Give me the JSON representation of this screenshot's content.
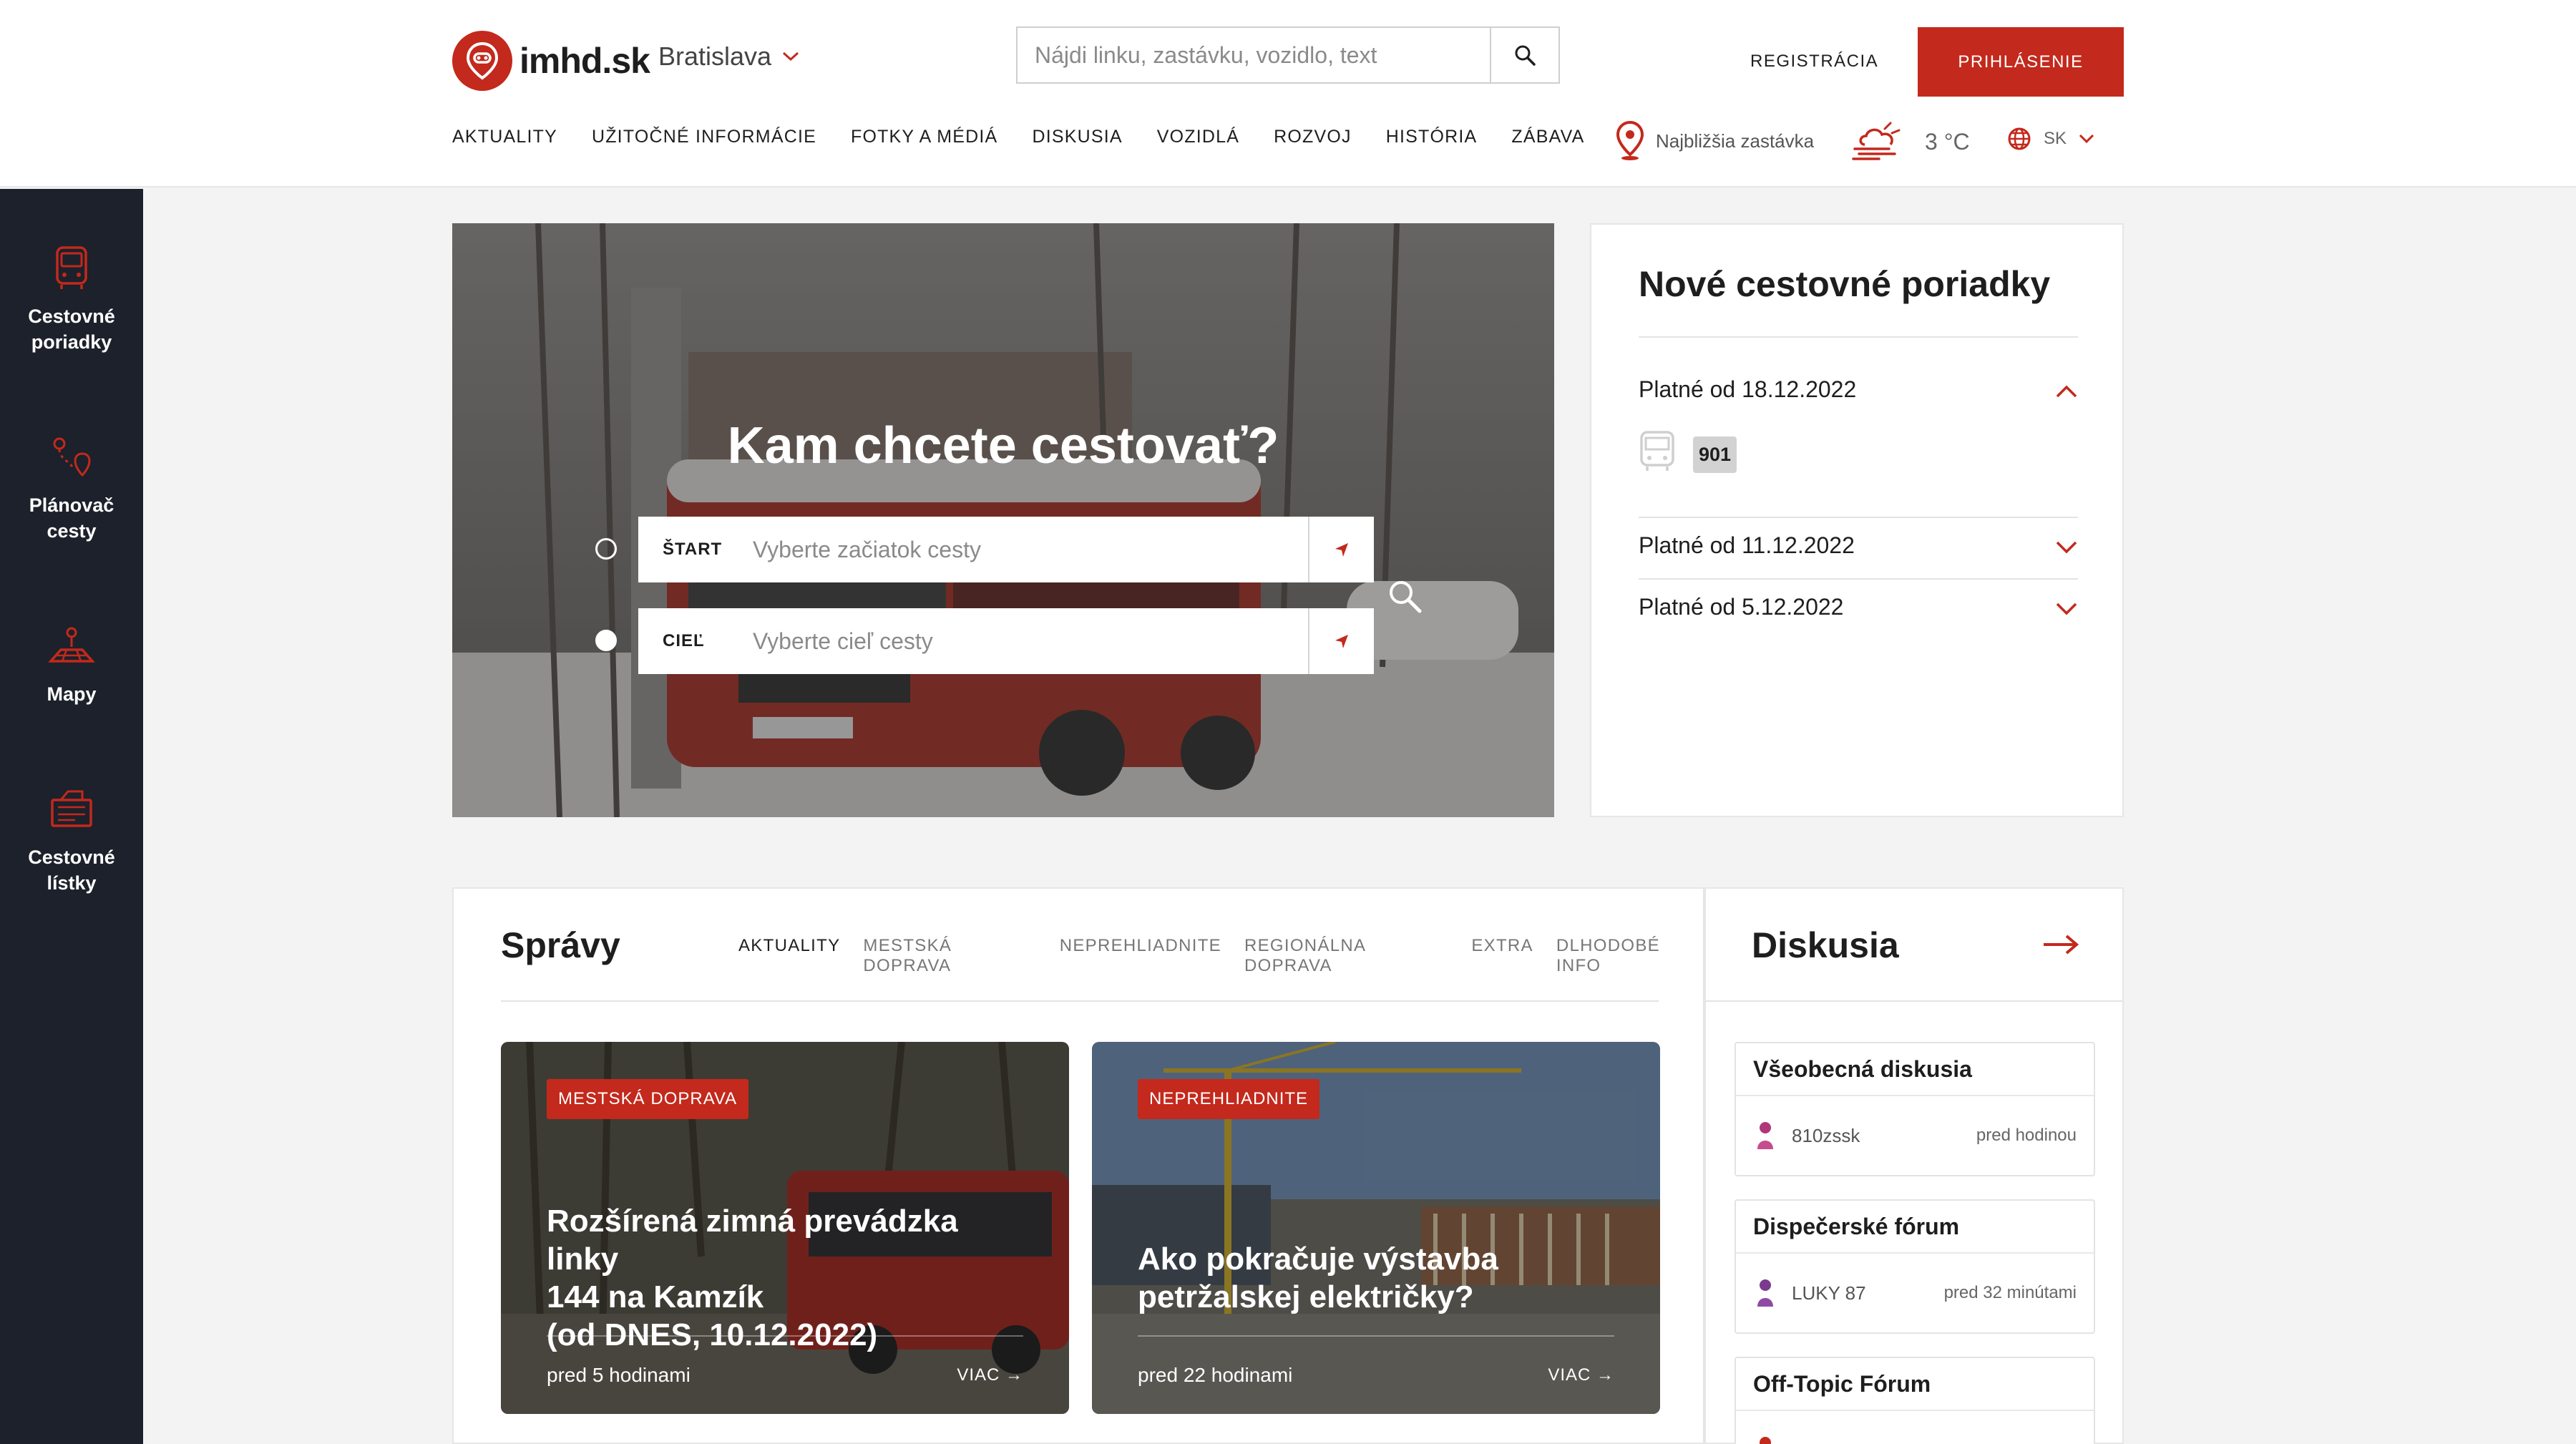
{
  "header": {
    "logo_text": "imhd.sk",
    "city": "Bratislava",
    "search_placeholder": "Nájdi linku, zastávku, vozidlo, text",
    "register": "REGISTRÁCIA",
    "login": "PRIHLÁSENIE",
    "nav": [
      "AKTUALITY",
      "UŽITOČNÉ INFORMÁCIE",
      "FOTKY A MÉDIÁ",
      "DISKUSIA",
      "VOZIDLÁ",
      "ROZVOJ",
      "HISTÓRIA",
      "ZÁBAVA"
    ],
    "nearest_stop": "Najbližšia zastávka",
    "temperature": "3 °C",
    "language": "SK"
  },
  "sidebar": {
    "items": [
      {
        "label_1": "Cestovné",
        "label_2": "poriadky",
        "icon": "bus-icon"
      },
      {
        "label_1": "Plánovač",
        "label_2": "cesty",
        "icon": "route-planner-icon"
      },
      {
        "label_1": "Mapy",
        "label_2": "",
        "icon": "map-icon"
      },
      {
        "label_1": "Cestovné",
        "label_2": "lístky",
        "icon": "ticket-icon"
      }
    ]
  },
  "hero": {
    "title": "Kam chcete cestovať?",
    "start_label": "ŠTART",
    "start_placeholder": "Vyberte začiatok cesty",
    "end_label": "CIEĽ",
    "end_placeholder": "Vyberte cieľ cesty"
  },
  "timetables": {
    "title": "Nové cestovné poriadky",
    "groups": [
      {
        "label": "Platné od 18.12.2022",
        "expanded": true,
        "lines": [
          "901"
        ]
      },
      {
        "label": "Platné od 11.12.2022",
        "expanded": false
      },
      {
        "label": "Platné od 5.12.2022",
        "expanded": false
      }
    ]
  },
  "news": {
    "title": "Správy",
    "tabs": [
      "AKTUALITY",
      "MESTSKÁ DOPRAVA",
      "NEPREHLIADNITE",
      "REGIONÁLNA DOPRAVA",
      "EXTRA",
      "DLHODOBÉ INFO"
    ],
    "active_tab": "AKTUALITY",
    "cards": [
      {
        "category": "MESTSKÁ DOPRAVA",
        "title_1": "Rozšírená zimná prevádzka linky",
        "title_2": "144 na Kamzík",
        "title_3": "(od DNES, 10.12.2022)",
        "time": "pred 5 hodinami",
        "more": "VIAC"
      },
      {
        "category": "NEPREHLIADNITE",
        "title_1": "Ako pokračuje výstavba",
        "title_2": "petržalskej električky?",
        "time": "pred 22 hodinami",
        "more": "VIAC"
      }
    ]
  },
  "discussion": {
    "title": "Diskusia",
    "forums": [
      {
        "name": "Všeobecná diskusia",
        "user": "810zssk",
        "when": "pred hodinou"
      },
      {
        "name": "Dispečerské fórum",
        "user": "LUKY 87",
        "when": "pred 32 minútami"
      },
      {
        "name": "Off-Topic Fórum",
        "user": "",
        "when": ""
      }
    ]
  },
  "colors": {
    "accent": "#c3291c",
    "sidebar": "#1c212b"
  }
}
